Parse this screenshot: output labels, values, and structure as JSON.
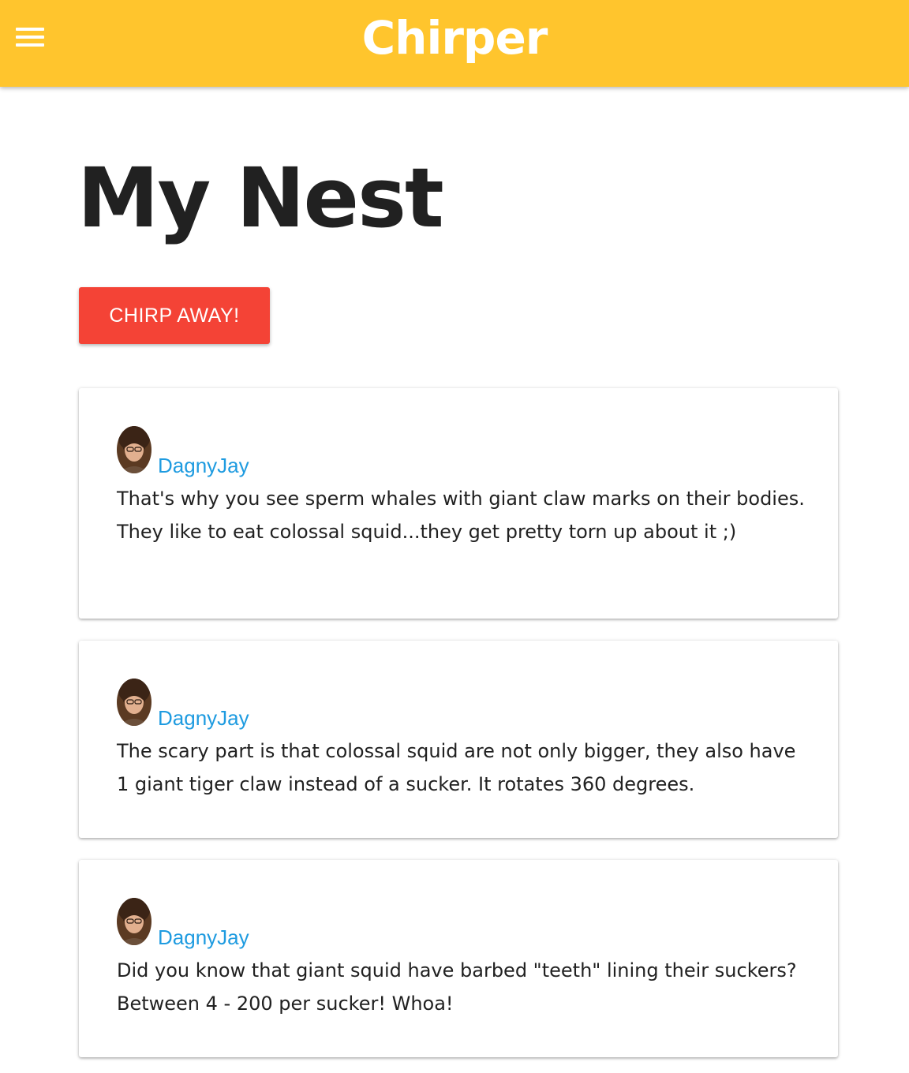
{
  "appbar": {
    "brand": "Chirper",
    "menu_icon": "hamburger-menu-icon",
    "background_color": "#ffc52d"
  },
  "page": {
    "title": "My Nest"
  },
  "actions": {
    "chirp_button_label": "CHIRP AWAY!",
    "chirp_button_color": "#f44336"
  },
  "chirps": [
    {
      "username": "DagnyJay",
      "avatar_icon": "user-avatar-photo",
      "text": "That's why you see sperm whales with giant claw marks on their bodies. They like to eat colossal squid...they get pretty torn up about it ;)"
    },
    {
      "username": "DagnyJay",
      "avatar_icon": "user-avatar-photo",
      "text": "The scary part is that colossal squid are not only bigger, they also have 1 giant tiger claw instead of a sucker. It rotates 360 degrees."
    },
    {
      "username": "DagnyJay",
      "avatar_icon": "user-avatar-photo",
      "text": "Did you know that giant squid have barbed \"teeth\" lining their suckers? Between 4 - 200 per sucker! Whoa!"
    }
  ],
  "colors": {
    "username_link": "#1e9be0",
    "text": "#212121"
  }
}
